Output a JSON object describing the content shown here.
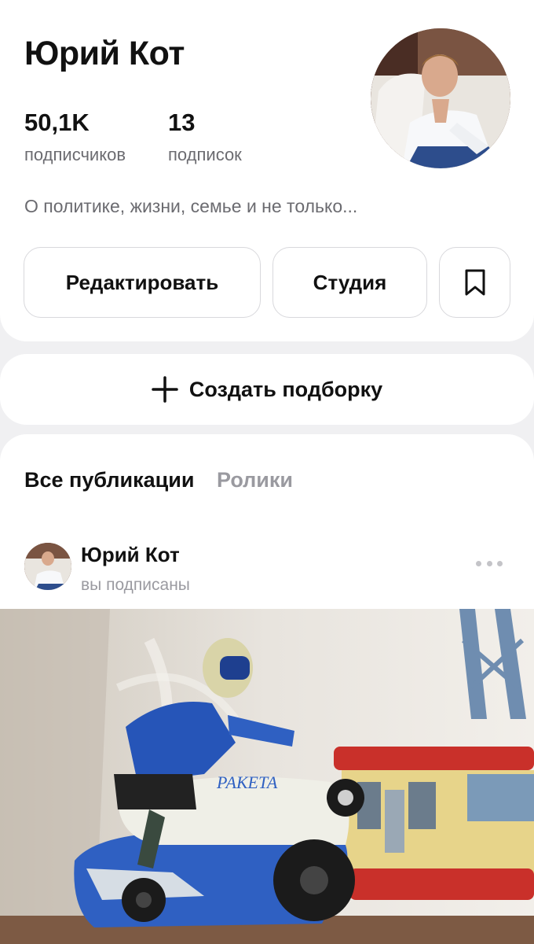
{
  "profile": {
    "name": "Юрий Кот",
    "followers_count": "50,1K",
    "followers_label": "подписчиков",
    "following_count": "13",
    "following_label": "подписок",
    "bio": "О политике, жизни, семье и не только..."
  },
  "actions": {
    "edit_label": "Редактировать",
    "studio_label": "Студия",
    "bookmark_icon": "bookmark-icon"
  },
  "create_collection": {
    "label": "Создать подборку",
    "icon": "plus-icon"
  },
  "feed": {
    "tabs": [
      {
        "label": "Все публикации",
        "active": true
      },
      {
        "label": "Ролики",
        "active": false
      }
    ],
    "post": {
      "author": "Юрий Кот",
      "status": "вы подписаны",
      "more_icon": "more-dots-icon",
      "image_caption_text": "РАКЕТА"
    }
  },
  "colors": {
    "background": "#f0f0f2",
    "card": "#ffffff",
    "muted_text": "#6b6b70",
    "inactive_tab": "#9a9aa0",
    "button_border": "#d8d8dc"
  }
}
